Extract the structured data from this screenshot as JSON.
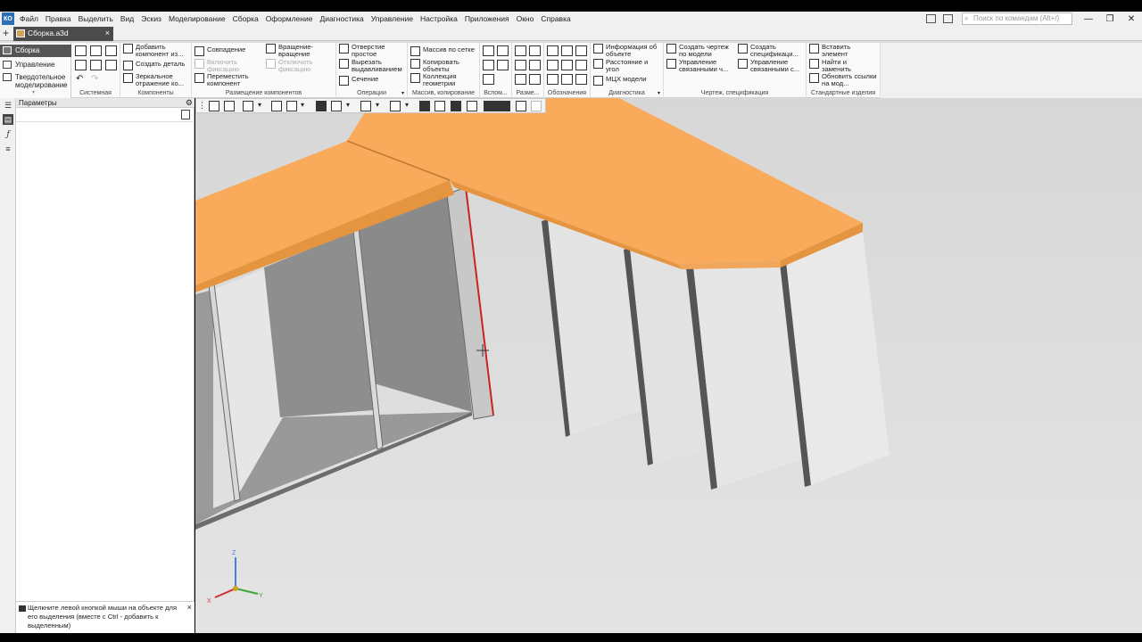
{
  "menu": {
    "logo": "КО",
    "items": [
      "Файл",
      "Правка",
      "Выделить",
      "Вид",
      "Эскиз",
      "Моделирование",
      "Сборка",
      "Оформление",
      "Диагностика",
      "Управление",
      "Настройка",
      "Приложения",
      "Окно",
      "Справка"
    ],
    "search_placeholder": "Поиск по командам (Alt+/)"
  },
  "tabs": {
    "plus": "+",
    "doc_tab": "Сборка.a3d",
    "close": "×"
  },
  "left_panel": {
    "items": [
      "Сборка",
      "Управление",
      "Твердотельное моделирование"
    ]
  },
  "ribbon": {
    "groups": {
      "system": "Системная",
      "components": "Компоненты",
      "placement": "Размещение компонентов",
      "operations": "Операции",
      "array": "Массив, копирование",
      "aux": "Вспом...",
      "dims": "Разме...",
      "designations": "Обозначения",
      "diagnostics": "Диагностика",
      "drawing_spec": "Чертеж, спецификация",
      "std_parts": "Стандартные изделия"
    },
    "buttons": {
      "add_component": "Добавить компонент из...",
      "create_part": "Создать деталь",
      "mirror_component": "Зеркальное отражение ко...",
      "coincidence": "Совпадение",
      "enable_fixation": "Включить фиксацию",
      "move_component": "Переместить компонент",
      "move_rotate": "Вращение-вращение",
      "disable_fixation": "Отключить фиксацию",
      "simple_hole": "Отверстие простое",
      "cut_extrude": "Вырезать выдавливанием",
      "section": "Сечение",
      "grid_array": "Массив по сетке",
      "copy_objects": "Копировать объекты",
      "geometry_collection": "Коллекция геометрии",
      "object_info": "Информация об объекте",
      "distance_angle": "Расстояние и угол",
      "mcx_model": "МЦХ модели",
      "create_drawing": "Создать чертеж по модели",
      "manage_linked": "Управление связанными ч...",
      "create_spec": "Создать спецификаци...",
      "manage_linked_spec": "Управление связанными с...",
      "insert_element": "Вставить элемент",
      "find_replace": "Найти и заменить",
      "update_links": "Обновить ссылки на мод..."
    }
  },
  "params": {
    "title": "Параметры",
    "hint": "Щелкните левой кнопкой мыши на объекте для его выделения (вместе с Ctrl - добавить к выделенным)"
  },
  "axes": {
    "x": "X",
    "y": "Y",
    "z": "Z"
  },
  "colors": {
    "tabletop": "#f9aa5a",
    "tabletop_edge": "#e59440",
    "panel_light": "#e8e8e8",
    "panel_dark": "#8f8f8f",
    "selected_edge": "#cc2222",
    "doc_tab": "#4b4b4b"
  }
}
